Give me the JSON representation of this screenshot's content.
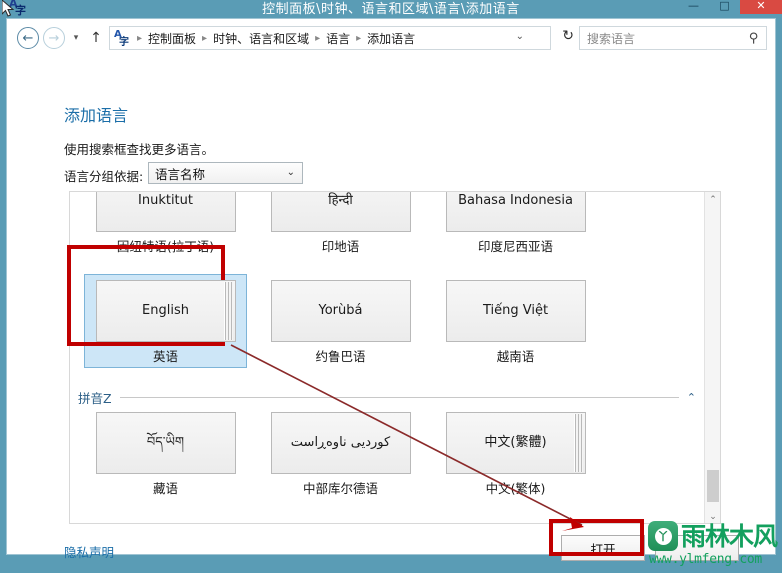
{
  "window": {
    "title": "控制面板\\时钟、语言和区域\\语言\\添加语言",
    "icon": "language-icon",
    "controls": {
      "minimize": "—",
      "maximize": "□",
      "close": "✕"
    }
  },
  "navbar": {
    "back_icon": "←",
    "forward_icon": "→",
    "history_caret": "▾",
    "up_icon": "↑",
    "address_icon": "language-icon",
    "breadcrumbs": [
      "控制面板",
      "时钟、语言和区域",
      "语言",
      "添加语言"
    ],
    "breadcrumb_separator": "▸",
    "address_caret": "⌄",
    "refresh_icon": "↻",
    "search_placeholder": "搜索语言",
    "search_value": "",
    "search_icon": "search-icon"
  },
  "page": {
    "title": "添加语言",
    "subtitle": "使用搜索框查找更多语言。",
    "groupby_label": "语言分组依据:",
    "groupby_value": "语言名称",
    "groupby_chevron": "⌄"
  },
  "list": {
    "rows": [
      {
        "clipped_top": true,
        "tiles": [
          {
            "native": "Inuktitut",
            "label": "因纽特语(拉丁语)",
            "stacked": false,
            "selected": false
          },
          {
            "native": "हिन्दी",
            "label": "印地语",
            "stacked": false,
            "selected": false
          },
          {
            "native": "Bahasa Indonesia",
            "label": "印度尼西亚语",
            "stacked": false,
            "selected": false
          }
        ]
      },
      {
        "clipped_top": false,
        "tiles": [
          {
            "native": "English",
            "label": "英语",
            "stacked": true,
            "selected": true
          },
          {
            "native": "Yorùbá",
            "label": "约鲁巴语",
            "stacked": false,
            "selected": false
          },
          {
            "native": "Tiếng Việt",
            "label": "越南语",
            "stacked": false,
            "selected": false
          }
        ]
      }
    ],
    "group": {
      "name": "拼音Z",
      "chevron": "⌃",
      "tiles": [
        {
          "native": "བོད་ཡིག",
          "label": "藏语",
          "stacked": false,
          "selected": false
        },
        {
          "native": "كوردیی ناوەڕاست",
          "label": "中部库尔德语",
          "stacked": false,
          "selected": false
        },
        {
          "native": "中文(繁體)",
          "label": "中文(繁体)",
          "stacked": true,
          "selected": false
        }
      ]
    },
    "scrollbar": {
      "up_arrow": "⌃",
      "down_arrow": "⌄"
    }
  },
  "footer": {
    "privacy_link": "隐私声明",
    "open_button": "打开",
    "cancel_button": ""
  },
  "annotations": {
    "highlight_color": "#c00000",
    "arrow_from": "english-tile",
    "arrow_to": "open-button"
  },
  "watermark": {
    "brand": "雨林木风",
    "url": "www.ylmfeng.com",
    "logo_glyph": "丫",
    "color": "#13a05e"
  }
}
